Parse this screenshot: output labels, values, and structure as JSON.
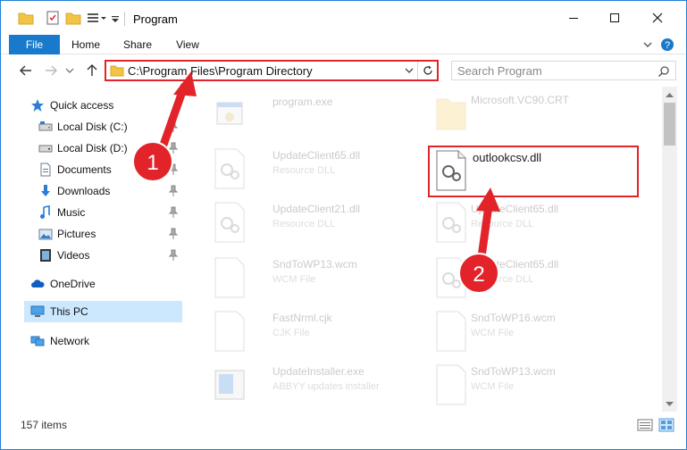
{
  "window": {
    "title": "Program"
  },
  "ribbon": {
    "tabs": [
      {
        "label": "File"
      },
      {
        "label": "Home"
      },
      {
        "label": "Share"
      },
      {
        "label": "View"
      }
    ]
  },
  "address": {
    "path": "C:\\Program Files\\Program Directory",
    "search_placeholder": "Search Program"
  },
  "sidebar": {
    "items": [
      {
        "label": "Quick access",
        "icon": "star-icon",
        "pinned": false
      },
      {
        "label": "Local Disk (C:)",
        "icon": "drive-icon",
        "pinned": true
      },
      {
        "label": "Local Disk (D:)",
        "icon": "drive-icon",
        "pinned": true
      },
      {
        "label": "Documents",
        "icon": "documents-icon",
        "pinned": true
      },
      {
        "label": "Downloads",
        "icon": "download-icon",
        "pinned": true
      },
      {
        "label": "Music",
        "icon": "music-icon",
        "pinned": true
      },
      {
        "label": "Pictures",
        "icon": "pictures-icon",
        "pinned": true
      },
      {
        "label": "Videos",
        "icon": "videos-icon",
        "pinned": true
      },
      {
        "label": "OneDrive",
        "icon": "cloud-icon",
        "pinned": false
      },
      {
        "label": "This PC",
        "icon": "computer-icon",
        "pinned": false,
        "selected": true
      },
      {
        "label": "Network",
        "icon": "network-icon",
        "pinned": false
      }
    ]
  },
  "files": [
    {
      "name": "program.exe",
      "type": "",
      "icon": "exe-icon"
    },
    {
      "name": "Microsoft.VC90.CRT",
      "type": "",
      "icon": "folder-icon"
    },
    {
      "name": "UpdateClient65.dll",
      "type": "Resource DLL",
      "icon": "dll-icon"
    },
    {
      "name": "outlookcsv.dll",
      "type": "",
      "icon": "dll-icon"
    },
    {
      "name": "UpdateClient21.dll",
      "type": "Resource DLL",
      "icon": "dll-icon"
    },
    {
      "name": "UpdateClient65.dll",
      "type": "Resource DLL",
      "icon": "dll-icon"
    },
    {
      "name": "SndToWP13.wcm",
      "type": "WCM File",
      "icon": "file-icon"
    },
    {
      "name": "UpdateClient65.dll",
      "type": "Resource DLL",
      "icon": "dll-icon"
    },
    {
      "name": "FastNrml.cjk",
      "type": "CJK File",
      "icon": "file-icon"
    },
    {
      "name": "SndToWP16.wcm",
      "type": "WCM File",
      "icon": "file-icon"
    },
    {
      "name": "UpdateInstaller.exe",
      "type": "ABBYY updates installer",
      "icon": "installer-icon"
    },
    {
      "name": "SndToWP13.wcm",
      "type": "WCM File",
      "icon": "file-icon"
    }
  ],
  "status": {
    "item_count": "157 items"
  },
  "annotations": [
    {
      "label": "1"
    },
    {
      "label": "2"
    }
  ],
  "colors": {
    "accent": "#1979ca",
    "highlight_red": "#e2242a",
    "selected_bg": "#cce8ff"
  }
}
